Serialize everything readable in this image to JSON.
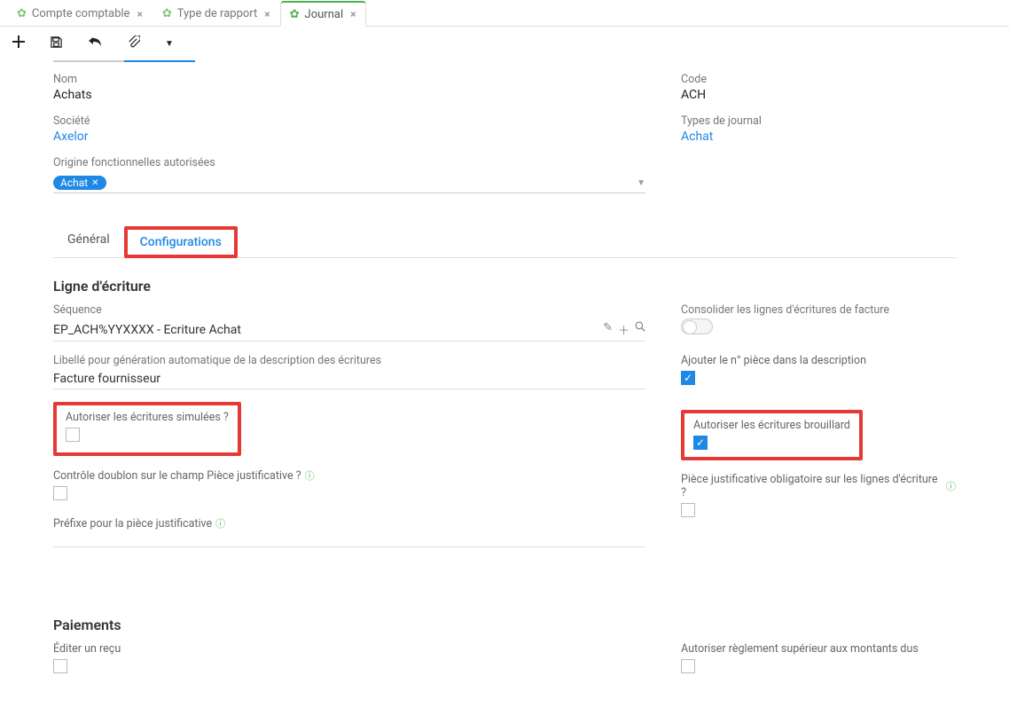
{
  "tabs": [
    {
      "label": "Compte comptable"
    },
    {
      "label": "Type de rapport"
    },
    {
      "label": "Journal"
    }
  ],
  "header": {
    "name_label": "Nom",
    "name_value": "Achats",
    "company_label": "Société",
    "company_value": "Axelor",
    "origin_label": "Origine fonctionnelles autorisées",
    "origin_chip": "Achat",
    "code_label": "Code",
    "code_value": "ACH",
    "jtype_label": "Types de journal",
    "jtype_value": "Achat"
  },
  "inner_tabs": {
    "general": "Général",
    "config": "Configurations"
  },
  "section_line": "Ligne d'écriture",
  "sequence": {
    "label": "Séquence",
    "value": "EP_ACH%YYXXXX - Ecriture Achat"
  },
  "libelle": {
    "label": "Libellé pour génération automatique de la description des écritures",
    "value": "Facture fournisseur"
  },
  "consolidate_label": "Consolider les lignes d'écritures de facture",
  "addpiece_label": "Ajouter le n° pièce dans la description",
  "simulated_label": "Autoriser les écritures simulées ?",
  "draft_label": "Autoriser les écritures brouillard",
  "doublon_label": "Contrôle doublon sur le champ Pièce justificative ?",
  "mandatory_label": "Pièce justificative obligatoire sur les lignes d'écriture ?",
  "prefix_label": "Préfixe pour la pièce justificative",
  "section_pay": "Paiements",
  "receipt_label": "Éditer un reçu",
  "overpay_label": "Autoriser règlement supérieur aux montants dus"
}
